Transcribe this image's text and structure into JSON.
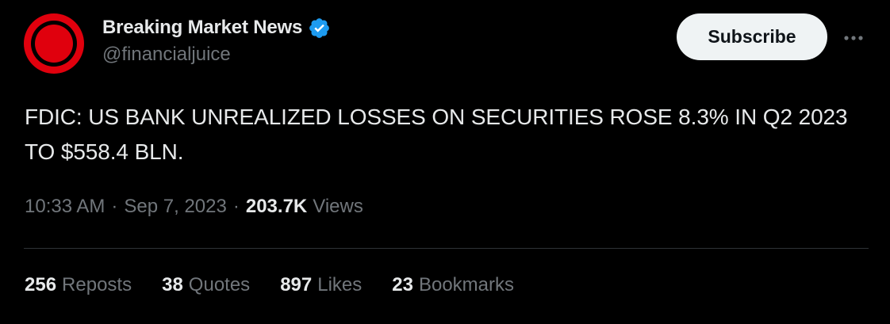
{
  "author": {
    "display_name": "Breaking Market News",
    "handle": "@financialjuice",
    "verified": true,
    "avatar_icon": "red-circle-logo"
  },
  "actions": {
    "subscribe_label": "Subscribe",
    "more_icon": "ellipsis-icon"
  },
  "tweet": {
    "text": "FDIC: US BANK UNREALIZED LOSSES ON SECURITIES ROSE 8.3% IN Q2 2023 TO $558.4 BLN."
  },
  "meta": {
    "time": "10:33 AM",
    "separator": "·",
    "date": "Sep 7, 2023",
    "views_count": "203.7K",
    "views_label": "Views"
  },
  "stats": [
    {
      "count": "256",
      "label": "Reposts"
    },
    {
      "count": "38",
      "label": "Quotes"
    },
    {
      "count": "897",
      "label": "Likes"
    },
    {
      "count": "23",
      "label": "Bookmarks"
    }
  ],
  "colors": {
    "background": "#000000",
    "text_primary": "#e7e9ea",
    "text_secondary": "#71767b",
    "divider": "#2f3336",
    "verified_blue": "#1d9bf0",
    "avatar_red": "#e0000d",
    "subscribe_bg": "#eff3f4"
  }
}
